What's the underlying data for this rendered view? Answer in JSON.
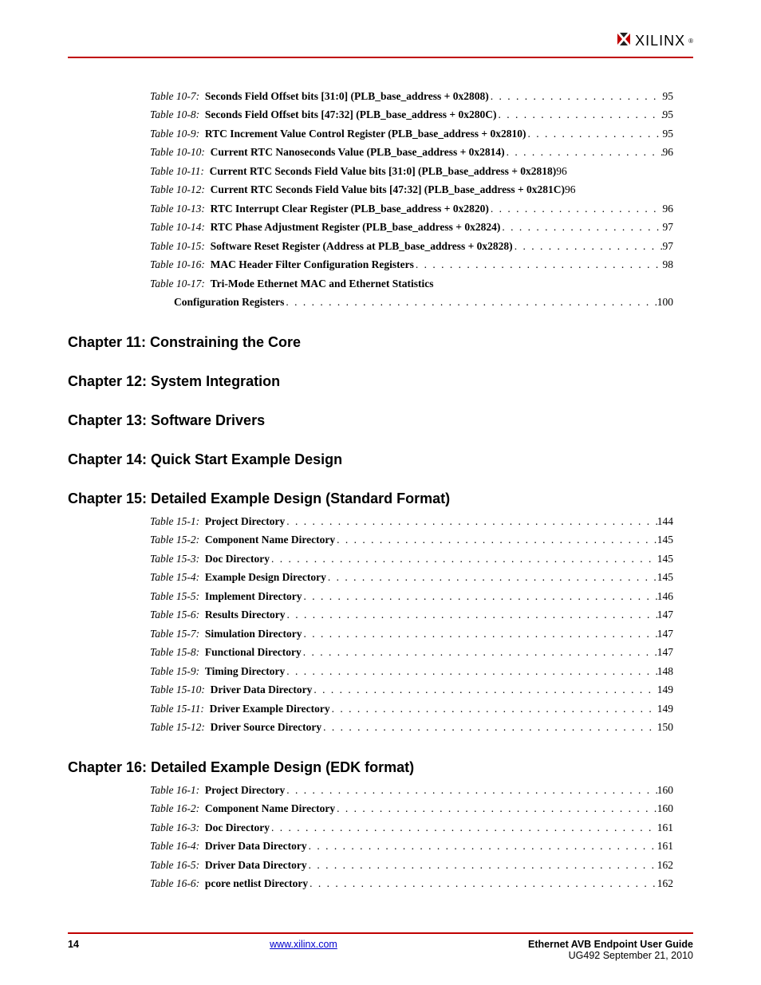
{
  "header": {
    "logo_text": "XILINX"
  },
  "sections": [
    {
      "entries": [
        {
          "label": "Table 10-7:",
          "title": "Seconds Field Offset bits [31:0] (PLB_base_address + 0x2808)",
          "page": "95",
          "dots": true
        },
        {
          "label": "Table 10-8:",
          "title": "Seconds Field Offset bits [47:32] (PLB_base_address + 0x280C)",
          "page": "95",
          "dots": true
        },
        {
          "label": "Table 10-9:",
          "title": "RTC Increment Value Control Register (PLB_base_address + 0x2810)",
          "page": "95",
          "dots": true
        },
        {
          "label": "Table 10-10:",
          "title": "Current RTC Nanoseconds Value (PLB_base_address + 0x2814)",
          "page": "96",
          "dots": true
        },
        {
          "label": "Table 10-11:",
          "title": "Current RTC Seconds Field Value bits [31:0] (PLB_base_address + 0x2818)",
          "page": "96",
          "dots": false
        },
        {
          "label": "Table 10-12:",
          "title": "Current RTC Seconds Field Value bits [47:32] (PLB_base_address + 0x281C)",
          "page": "96",
          "dots": false
        },
        {
          "label": "Table 10-13:",
          "title": "RTC Interrupt Clear Register (PLB_base_address + 0x2820)",
          "page": "96",
          "dots": true
        },
        {
          "label": "Table 10-14:",
          "title": "RTC Phase Adjustment Register (PLB_base_address + 0x2824)",
          "page": "97",
          "dots": true
        },
        {
          "label": "Table 10-15:",
          "title": "Software Reset Register (Address at PLB_base_address + 0x2828)",
          "page": "97",
          "dots": true
        },
        {
          "label": "Table 10-16:",
          "title": "MAC Header Filter Configuration Registers",
          "page": "98",
          "dots": true
        },
        {
          "label": "Table 10-17:",
          "title": "Tri-Mode Ethernet MAC and Ethernet Statistics",
          "cont_title": "Configuration Registers",
          "page": "100",
          "dots": true,
          "multiline": true
        }
      ]
    },
    {
      "heading": "Chapter 11:  Constraining the Core",
      "entries": []
    },
    {
      "heading": "Chapter 12:  System Integration",
      "entries": []
    },
    {
      "heading": "Chapter 13:  Software Drivers",
      "entries": []
    },
    {
      "heading": "Chapter 14:  Quick Start Example Design",
      "entries": []
    },
    {
      "heading": "Chapter 15:  Detailed Example Design (Standard Format)",
      "entries": [
        {
          "label": "Table 15-1:",
          "title": "Project Directory",
          "page": "144",
          "dots": true
        },
        {
          "label": "Table 15-2:",
          "title": "Component Name Directory",
          "page": "145",
          "dots": true
        },
        {
          "label": "Table 15-3:",
          "title": "Doc Directory",
          "page": "145",
          "dots": true
        },
        {
          "label": "Table 15-4:",
          "title": "Example Design Directory",
          "page": "145",
          "dots": true
        },
        {
          "label": "Table 15-5:",
          "title": "Implement Directory",
          "page": "146",
          "dots": true
        },
        {
          "label": "Table 15-6:",
          "title": "Results Directory",
          "page": "147",
          "dots": true
        },
        {
          "label": "Table 15-7:",
          "title": "Simulation Directory",
          "page": "147",
          "dots": true
        },
        {
          "label": "Table 15-8:",
          "title": "Functional Directory",
          "page": "147",
          "dots": true
        },
        {
          "label": "Table 15-9:",
          "title": "Timing Directory",
          "page": "148",
          "dots": true
        },
        {
          "label": "Table 15-10:",
          "title": "Driver Data Directory",
          "page": "149",
          "dots": true
        },
        {
          "label": "Table 15-11:",
          "title": "Driver Example Directory",
          "page": "149",
          "dots": true
        },
        {
          "label": "Table 15-12:",
          "title": "Driver Source Directory",
          "page": "150",
          "dots": true
        }
      ]
    },
    {
      "heading": "Chapter 16:  Detailed Example Design (EDK format)",
      "entries": [
        {
          "label": "Table 16-1:",
          "title": "Project Directory",
          "page": "160",
          "dots": true
        },
        {
          "label": "Table 16-2:",
          "title": "Component Name Directory",
          "page": "160",
          "dots": true
        },
        {
          "label": "Table 16-3:",
          "title": "Doc Directory",
          "page": "161",
          "dots": true
        },
        {
          "label": "Table 16-4:",
          "title": "Driver Data Directory",
          "page": "161",
          "dots": true
        },
        {
          "label": "Table 16-5:",
          "title": "Driver Data Directory",
          "page": "162",
          "dots": true
        },
        {
          "label": "Table 16-6:",
          "title": "pcore netlist Directory",
          "page": "162",
          "dots": true
        }
      ]
    }
  ],
  "footer": {
    "page_number": "14",
    "url": "www.xilinx.com",
    "doc_title": "Ethernet AVB Endpoint User Guide",
    "doc_sub": "UG492 September 21, 2010"
  }
}
